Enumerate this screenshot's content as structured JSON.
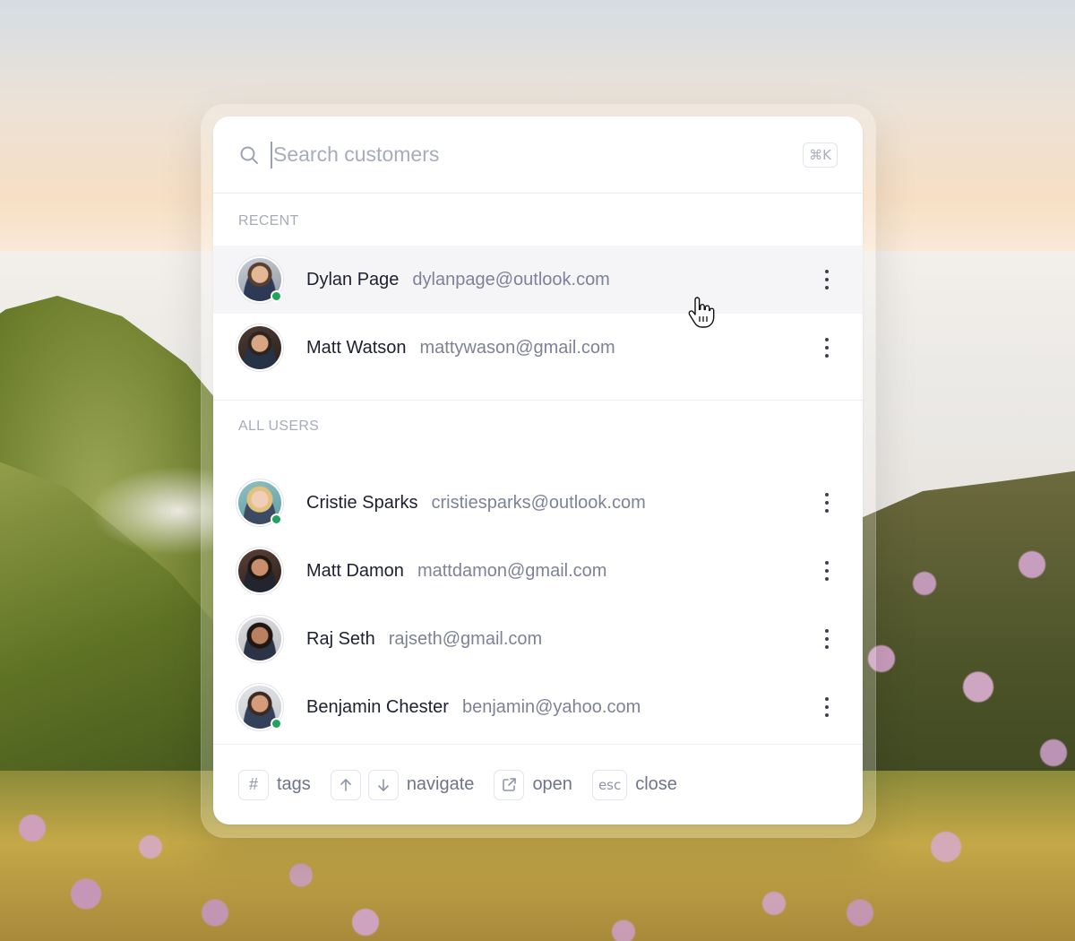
{
  "search": {
    "placeholder": "Search customers",
    "shortcut": "⌘K"
  },
  "sections": {
    "recent_label": "RECENT",
    "all_users_label": "ALL USERS"
  },
  "recent": [
    {
      "name": "Dylan Page",
      "email": "dylanpage@outlook.com",
      "online": true,
      "avatar_color": "#8a6a55"
    },
    {
      "name": "Matt Watson",
      "email": "mattywason@gmail.com",
      "online": false,
      "avatar_color": "#4a3a33"
    }
  ],
  "all_users": [
    {
      "name": "Cristie Sparks",
      "email": "cristiesparks@outlook.com",
      "online": true,
      "avatar_color": "#d9b77a"
    },
    {
      "name": "Matt Damon",
      "email": "mattdamon@gmail.com",
      "online": false,
      "avatar_color": "#3a2c26"
    },
    {
      "name": "Raj Seth",
      "email": "rajseth@gmail.com",
      "online": false,
      "avatar_color": "#3b2e2a"
    },
    {
      "name": "Benjamin Chester",
      "email": "benjamin@yahoo.com",
      "online": true,
      "avatar_color": "#5a4538"
    }
  ],
  "footer": {
    "tags_key": "#",
    "tags_label": "tags",
    "navigate_label": "navigate",
    "open_label": "open",
    "esc_key": "esc",
    "close_label": "close"
  },
  "colors": {
    "online": "#1fa45c",
    "active_row": "#f5f5f8"
  }
}
